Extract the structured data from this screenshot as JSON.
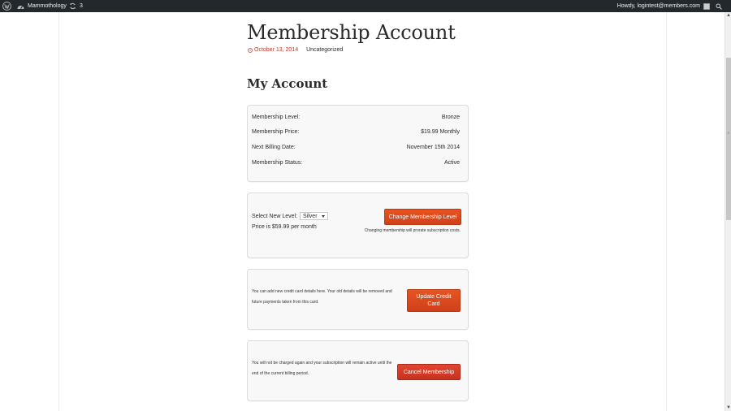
{
  "admin_bar": {
    "site_name": "Mammothology",
    "updates_count": "3",
    "howdy": "Howdy, logintest@members.com",
    "icons": [
      "wordpress-icon",
      "dashboard-icon",
      "updates-icon",
      "avatar",
      "search-icon"
    ]
  },
  "post": {
    "title": "Membership Account",
    "date": "October 13, 2014",
    "category": "Uncategorized"
  },
  "account": {
    "heading": "My Account",
    "rows": [
      {
        "label": "Membership Level:",
        "value": "Bronze"
      },
      {
        "label": "Membership Price:",
        "value": "$19.99 Monthly"
      },
      {
        "label": "Next Billing Date:",
        "value": "November 15th 2014"
      },
      {
        "label": "Membership Status:",
        "value": "Active"
      }
    ]
  },
  "change_level": {
    "label": "Select New Level:",
    "selected": "Silver",
    "price_text": "Price is $59.99 per month",
    "button": "Change Membership Level",
    "note": "Changing membership will prorate subscription costs."
  },
  "credit_card": {
    "text": "You can add new credit card details here. Your old details will be removed and future payments taken from this card.",
    "button": "Update Credit Card"
  },
  "cancel": {
    "text": "You will not be charged again and your subscription will remain active until the end of the current billing period.",
    "button": "Cancel Membership"
  },
  "colors": {
    "admin_bar": "#23282d",
    "accent": "#e04e1e",
    "cancel": "#d63a24",
    "date": "#c0392b"
  }
}
